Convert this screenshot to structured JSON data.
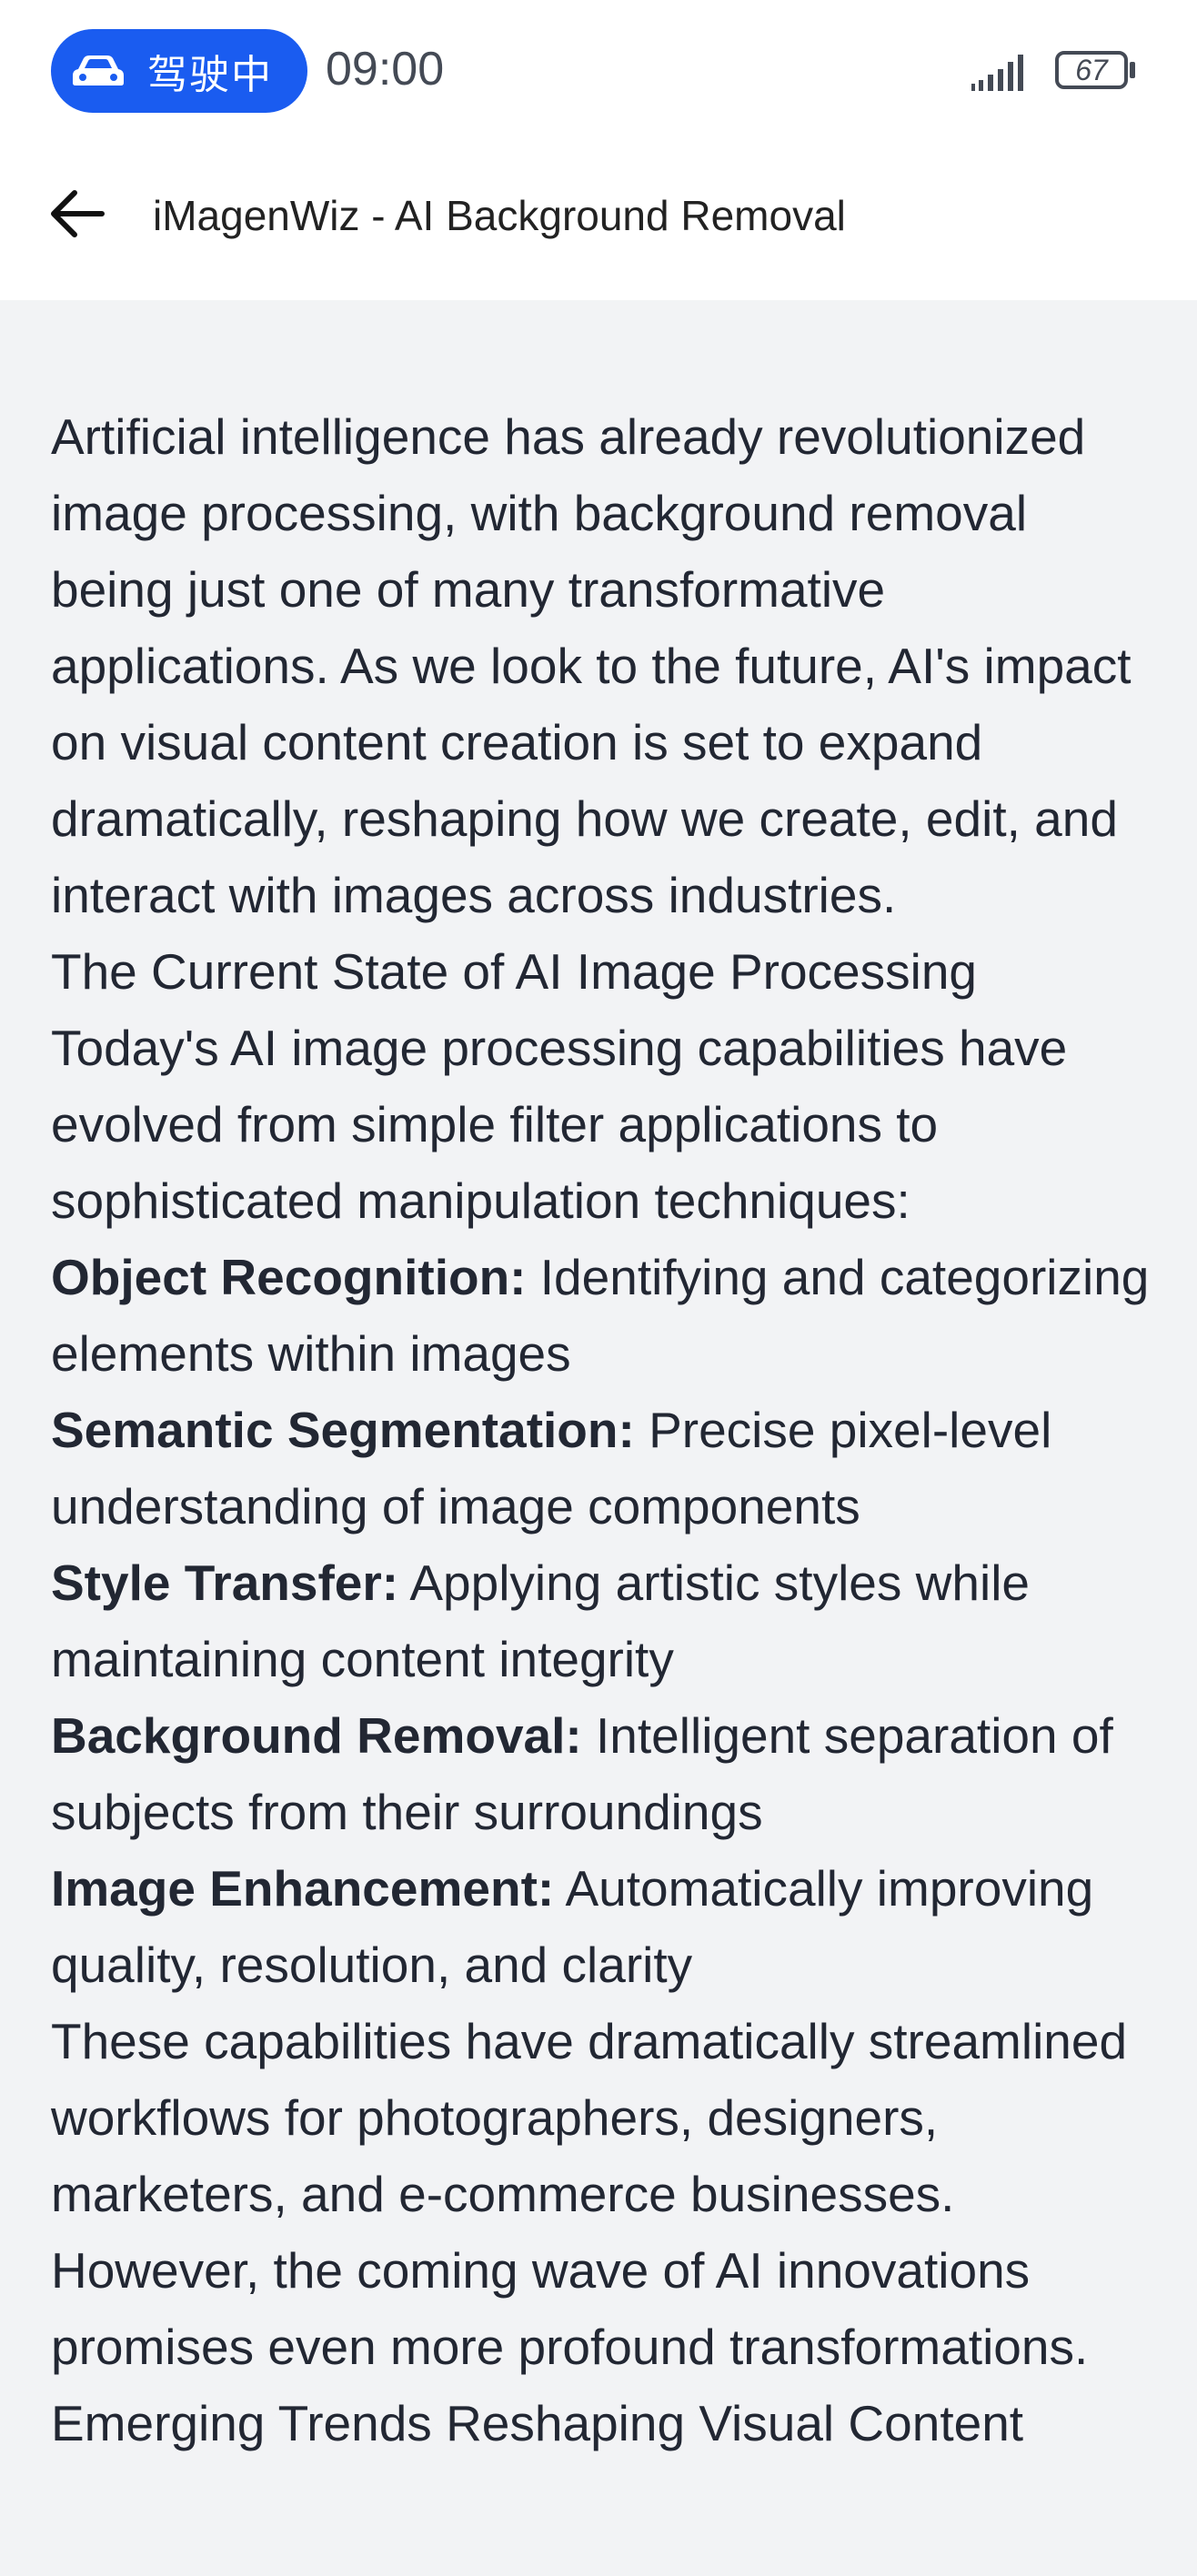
{
  "status_bar": {
    "driving_label": "驾驶中",
    "time": "09:00",
    "battery_level": "67",
    "accent_color": "#1a5cf0"
  },
  "nav": {
    "title": "iMagenWiz - AI Background Removal",
    "back_icon": "arrow-left-icon"
  },
  "article": {
    "intro": "Artificial intelligence has already revolutionized image processing, with background removal being just one of many transformative applications. As we look to the future, AI's impact on visual content creation is set to expand dramatically, reshaping how we create, edit, and interact with images across industries.",
    "section_heading": "The Current State of AI Image Processing",
    "section_intro": "Today's AI image processing capabilities have evolved from simple filter applications to sophisticated manipulation techniques:",
    "capabilities": [
      {
        "term": "Object Recognition:",
        "desc": " Identifying and categorizing elements within images"
      },
      {
        "term": "Semantic Segmentation:",
        "desc": " Precise pixel-level understanding of image components"
      },
      {
        "term": "Style Transfer:",
        "desc": " Applying artistic styles while maintaining content integrity"
      },
      {
        "term": "Background Removal:",
        "desc": " Intelligent separation of subjects from their surroundings"
      },
      {
        "term": "Image Enhancement:",
        "desc": " Automatically improving quality, resolution, and clarity"
      }
    ],
    "closing": "These capabilities have dramatically streamlined workflows for photographers, designers, marketers, and e-commerce businesses. However, the coming wave of AI innovations promises even more profound transformations.",
    "next_heading": "Emerging Trends Reshaping Visual Content"
  }
}
